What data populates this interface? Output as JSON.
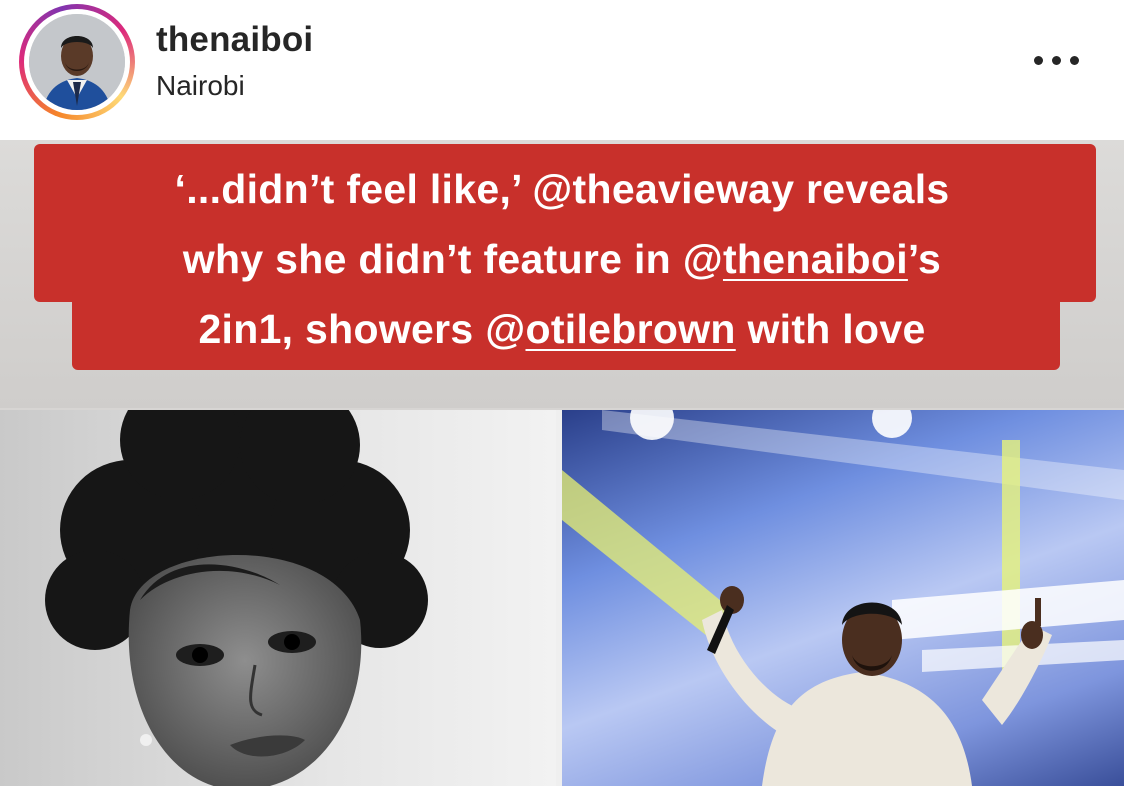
{
  "post": {
    "username": "thenaiboi",
    "location": "Nairobi",
    "more_icon": "more-horizontal-icon"
  },
  "image": {
    "caption": {
      "line1": "‘...didn’t feel like,’ @theavieway reveals",
      "line2_before": "why she didn’t feature in @",
      "line2_mention": "thenaiboi",
      "line2_after": "’s",
      "line3_before": "2in1, showers @",
      "line3_mention": "otilebrown",
      "line3_after": " with love"
    },
    "colors": {
      "banner_red": "#c8302b",
      "stage_blue": "#6f8fe0"
    }
  }
}
